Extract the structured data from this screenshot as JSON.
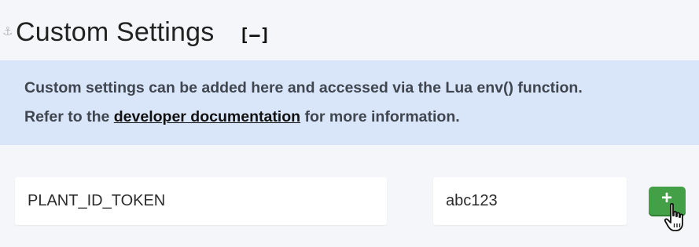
{
  "section": {
    "title": "Custom Settings",
    "collapse_label": "[–]"
  },
  "info": {
    "line1": "Custom settings can be added here and accessed via the Lua env() function.",
    "line2_prefix": "Refer to the ",
    "link_text": "developer documentation",
    "line2_suffix": " for more information."
  },
  "setting": {
    "key_value": "PLANT_ID_TOKEN",
    "value_value": "abc123"
  },
  "add_button": {
    "label": "+",
    "color": "#43a047"
  },
  "icons": {
    "anchor": "anchor-icon",
    "cursor": "hand-pointer-icon"
  }
}
